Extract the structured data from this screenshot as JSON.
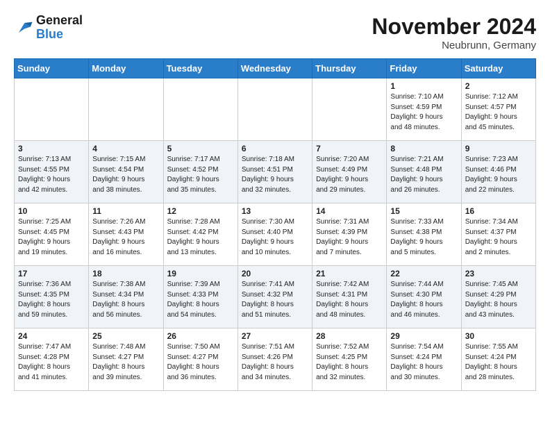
{
  "logo": {
    "line1": "General",
    "line2": "Blue"
  },
  "title": "November 2024",
  "location": "Neubrunn, Germany",
  "weekdays": [
    "Sunday",
    "Monday",
    "Tuesday",
    "Wednesday",
    "Thursday",
    "Friday",
    "Saturday"
  ],
  "weeks": [
    [
      {
        "day": "",
        "sunrise": "",
        "sunset": "",
        "daylight": ""
      },
      {
        "day": "",
        "sunrise": "",
        "sunset": "",
        "daylight": ""
      },
      {
        "day": "",
        "sunrise": "",
        "sunset": "",
        "daylight": ""
      },
      {
        "day": "",
        "sunrise": "",
        "sunset": "",
        "daylight": ""
      },
      {
        "day": "",
        "sunrise": "",
        "sunset": "",
        "daylight": ""
      },
      {
        "day": "1",
        "sunrise": "Sunrise: 7:10 AM",
        "sunset": "Sunset: 4:59 PM",
        "daylight": "Daylight: 9 hours and 48 minutes."
      },
      {
        "day": "2",
        "sunrise": "Sunrise: 7:12 AM",
        "sunset": "Sunset: 4:57 PM",
        "daylight": "Daylight: 9 hours and 45 minutes."
      }
    ],
    [
      {
        "day": "3",
        "sunrise": "Sunrise: 7:13 AM",
        "sunset": "Sunset: 4:55 PM",
        "daylight": "Daylight: 9 hours and 42 minutes."
      },
      {
        "day": "4",
        "sunrise": "Sunrise: 7:15 AM",
        "sunset": "Sunset: 4:54 PM",
        "daylight": "Daylight: 9 hours and 38 minutes."
      },
      {
        "day": "5",
        "sunrise": "Sunrise: 7:17 AM",
        "sunset": "Sunset: 4:52 PM",
        "daylight": "Daylight: 9 hours and 35 minutes."
      },
      {
        "day": "6",
        "sunrise": "Sunrise: 7:18 AM",
        "sunset": "Sunset: 4:51 PM",
        "daylight": "Daylight: 9 hours and 32 minutes."
      },
      {
        "day": "7",
        "sunrise": "Sunrise: 7:20 AM",
        "sunset": "Sunset: 4:49 PM",
        "daylight": "Daylight: 9 hours and 29 minutes."
      },
      {
        "day": "8",
        "sunrise": "Sunrise: 7:21 AM",
        "sunset": "Sunset: 4:48 PM",
        "daylight": "Daylight: 9 hours and 26 minutes."
      },
      {
        "day": "9",
        "sunrise": "Sunrise: 7:23 AM",
        "sunset": "Sunset: 4:46 PM",
        "daylight": "Daylight: 9 hours and 22 minutes."
      }
    ],
    [
      {
        "day": "10",
        "sunrise": "Sunrise: 7:25 AM",
        "sunset": "Sunset: 4:45 PM",
        "daylight": "Daylight: 9 hours and 19 minutes."
      },
      {
        "day": "11",
        "sunrise": "Sunrise: 7:26 AM",
        "sunset": "Sunset: 4:43 PM",
        "daylight": "Daylight: 9 hours and 16 minutes."
      },
      {
        "day": "12",
        "sunrise": "Sunrise: 7:28 AM",
        "sunset": "Sunset: 4:42 PM",
        "daylight": "Daylight: 9 hours and 13 minutes."
      },
      {
        "day": "13",
        "sunrise": "Sunrise: 7:30 AM",
        "sunset": "Sunset: 4:40 PM",
        "daylight": "Daylight: 9 hours and 10 minutes."
      },
      {
        "day": "14",
        "sunrise": "Sunrise: 7:31 AM",
        "sunset": "Sunset: 4:39 PM",
        "daylight": "Daylight: 9 hours and 7 minutes."
      },
      {
        "day": "15",
        "sunrise": "Sunrise: 7:33 AM",
        "sunset": "Sunset: 4:38 PM",
        "daylight": "Daylight: 9 hours and 5 minutes."
      },
      {
        "day": "16",
        "sunrise": "Sunrise: 7:34 AM",
        "sunset": "Sunset: 4:37 PM",
        "daylight": "Daylight: 9 hours and 2 minutes."
      }
    ],
    [
      {
        "day": "17",
        "sunrise": "Sunrise: 7:36 AM",
        "sunset": "Sunset: 4:35 PM",
        "daylight": "Daylight: 8 hours and 59 minutes."
      },
      {
        "day": "18",
        "sunrise": "Sunrise: 7:38 AM",
        "sunset": "Sunset: 4:34 PM",
        "daylight": "Daylight: 8 hours and 56 minutes."
      },
      {
        "day": "19",
        "sunrise": "Sunrise: 7:39 AM",
        "sunset": "Sunset: 4:33 PM",
        "daylight": "Daylight: 8 hours and 54 minutes."
      },
      {
        "day": "20",
        "sunrise": "Sunrise: 7:41 AM",
        "sunset": "Sunset: 4:32 PM",
        "daylight": "Daylight: 8 hours and 51 minutes."
      },
      {
        "day": "21",
        "sunrise": "Sunrise: 7:42 AM",
        "sunset": "Sunset: 4:31 PM",
        "daylight": "Daylight: 8 hours and 48 minutes."
      },
      {
        "day": "22",
        "sunrise": "Sunrise: 7:44 AM",
        "sunset": "Sunset: 4:30 PM",
        "daylight": "Daylight: 8 hours and 46 minutes."
      },
      {
        "day": "23",
        "sunrise": "Sunrise: 7:45 AM",
        "sunset": "Sunset: 4:29 PM",
        "daylight": "Daylight: 8 hours and 43 minutes."
      }
    ],
    [
      {
        "day": "24",
        "sunrise": "Sunrise: 7:47 AM",
        "sunset": "Sunset: 4:28 PM",
        "daylight": "Daylight: 8 hours and 41 minutes."
      },
      {
        "day": "25",
        "sunrise": "Sunrise: 7:48 AM",
        "sunset": "Sunset: 4:27 PM",
        "daylight": "Daylight: 8 hours and 39 minutes."
      },
      {
        "day": "26",
        "sunrise": "Sunrise: 7:50 AM",
        "sunset": "Sunset: 4:27 PM",
        "daylight": "Daylight: 8 hours and 36 minutes."
      },
      {
        "day": "27",
        "sunrise": "Sunrise: 7:51 AM",
        "sunset": "Sunset: 4:26 PM",
        "daylight": "Daylight: 8 hours and 34 minutes."
      },
      {
        "day": "28",
        "sunrise": "Sunrise: 7:52 AM",
        "sunset": "Sunset: 4:25 PM",
        "daylight": "Daylight: 8 hours and 32 minutes."
      },
      {
        "day": "29",
        "sunrise": "Sunrise: 7:54 AM",
        "sunset": "Sunset: 4:24 PM",
        "daylight": "Daylight: 8 hours and 30 minutes."
      },
      {
        "day": "30",
        "sunrise": "Sunrise: 7:55 AM",
        "sunset": "Sunset: 4:24 PM",
        "daylight": "Daylight: 8 hours and 28 minutes."
      }
    ]
  ]
}
